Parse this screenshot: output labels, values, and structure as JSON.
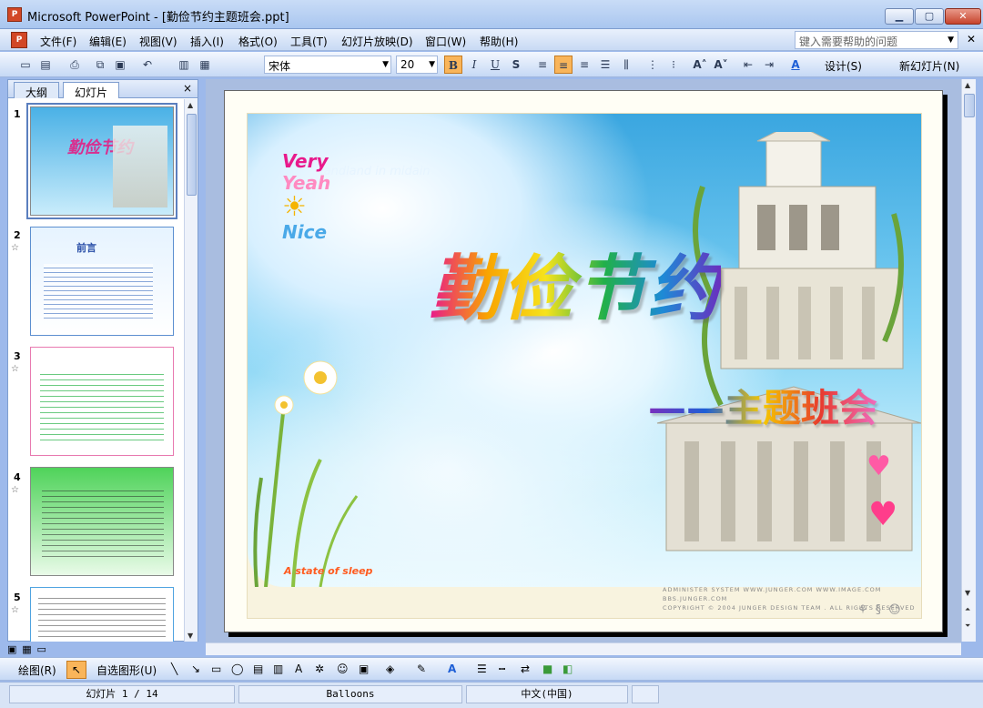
{
  "window": {
    "title": "Microsoft PowerPoint - [勤俭节约主题班会.ppt]",
    "app_icon": "powerpoint-icon"
  },
  "menu": {
    "items": [
      "文件(F)",
      "编辑(E)",
      "视图(V)",
      "插入(I)",
      "格式(O)",
      "工具(T)",
      "幻灯片放映(D)",
      "窗口(W)",
      "帮助(H)"
    ],
    "help_placeholder": "键入需要帮助的问题"
  },
  "toolbar": {
    "font": "宋体",
    "size": "20",
    "bold": "B",
    "italic": "I",
    "underline": "U",
    "shadow": "S",
    "design_label": "设计(S)",
    "new_slide_label": "新幻灯片(N)",
    "font_color_label": "A"
  },
  "left_pane": {
    "tab_outline": "大纲",
    "tab_slides": "幻灯片",
    "close": "×",
    "thumbnails": [
      {
        "num": "1",
        "title": "勤俭节约"
      },
      {
        "num": "2",
        "title": "前言"
      },
      {
        "num": "3",
        "title": ""
      },
      {
        "num": "4",
        "title": ""
      },
      {
        "num": "5",
        "title": ""
      }
    ]
  },
  "slide": {
    "main_title": "勤俭节约",
    "subtitle": "——主题班会",
    "deco_text": "landland in midain",
    "very": "Very",
    "yeah": "Yeah",
    "nice": "Nice",
    "sleep_text": "A state of sleep",
    "copyright_line1": "ADMINISTER SYSTEM   WWW.JUNGER.COM   WWW.IMAGE.COM   BBS.JUNGER.COM",
    "copyright_line2": "COPYRIGHT  ©  2004 JUNGER DESIGN TEAM . ALL RIGHTS RESERVED"
  },
  "drawbar": {
    "draw_label": "绘图(R)",
    "autoshape_label": "自选图形(U)"
  },
  "status": {
    "slide_info": "幻灯片 1 / 14",
    "design": "Balloons",
    "language": "中文(中国)"
  }
}
